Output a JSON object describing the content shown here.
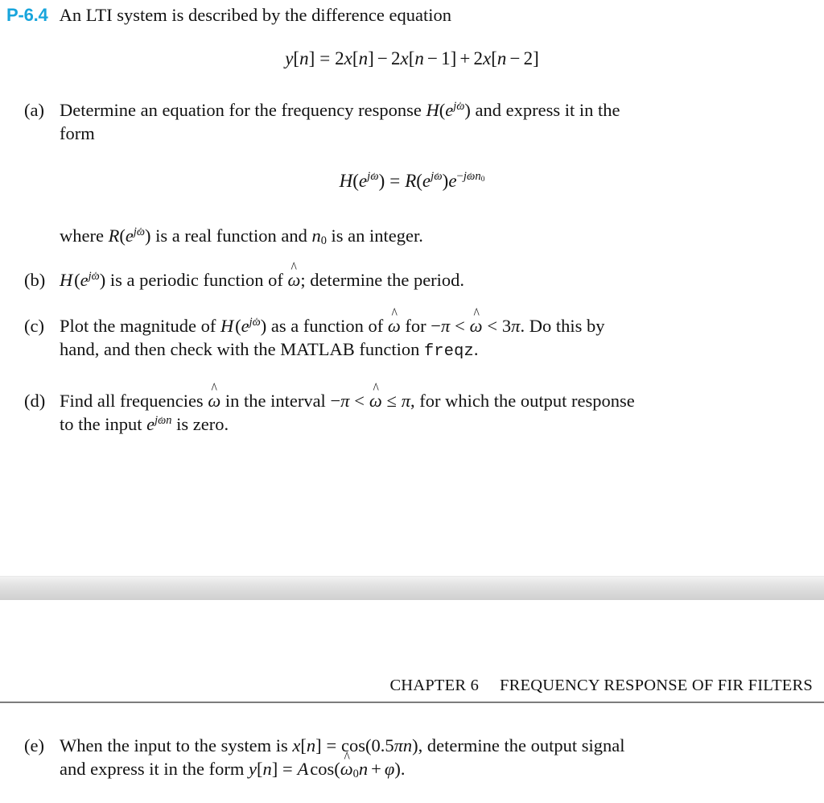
{
  "problem": {
    "number": "P-6.4",
    "statement": "An LTI system is described by the difference equation",
    "main_equation_plain": "y[n] = 2x[n] - 2x[n - 1] + 2x[n - 2]",
    "accent_color": "#18A5DC"
  },
  "parts": {
    "a": {
      "marker": "(a)",
      "text_plain": "Determine an equation for the frequency response H(e^{jω̂}) and express it in the form",
      "lead": "Determine an equation for the frequency response ",
      "tail": " and express it in the",
      "line2": "form",
      "display_equation_plain": "H(e^{jω̂}) = R(e^{jω̂}) e^{-jω̂ n_0}",
      "where_lead": "where ",
      "where_mid": " is a real function and ",
      "where_tail": " is an integer."
    },
    "b": {
      "marker": "(b)",
      "text_plain": "H(e^{jω̂}) is a periodic function of ω̂; determine the period.",
      "tail": " is a periodic function of "
    },
    "c": {
      "marker": "(c)",
      "text_plain": "Plot the magnitude of H(e^{jω̂}) as a function of ω̂ for -π < ω̂ < 3π. Do this by hand, and then check with the MATLAB function freqz.",
      "seg1": "Plot the magnitude of ",
      "seg2": " as a function of ",
      "seg3": " for ",
      "seg4": ". Do this by",
      "line2_seg1": "hand, and then check with the MATLAB function ",
      "matlab_function": "freqz",
      "line2_seg2": "."
    },
    "d": {
      "marker": "(d)",
      "text_plain": "Find all frequencies ω̂ in the interval -π < ω̂ ≤ π, for which the output response to the input e^{jω̂ n} is zero.",
      "seg1": "Find all frequencies ",
      "seg2": " in the interval ",
      "seg3": ", for which the output response",
      "line2_seg1": "to the input ",
      "line2_seg2": " is zero."
    },
    "e": {
      "marker": "(e)",
      "text_plain": "When the input to the system is x[n] = cos(0.5πn), determine the output signal and express it in the form y[n] = A cos(ω̂_0 n + φ).",
      "seg1": "When the input to the system is ",
      "seg2": ", determine the output signal",
      "line2_seg1": "and express it in the form ",
      "line2_seg2": "."
    }
  },
  "running_head": {
    "chapter": "CHAPTER 6",
    "title": "FREQUENCY RESPONSE OF FIR FILTERS"
  }
}
